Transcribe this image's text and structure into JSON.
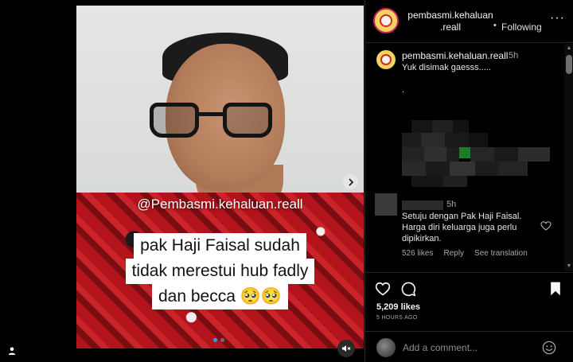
{
  "media": {
    "handle_overlay": "@Pembasmi.kehaluan.reall",
    "caption_lines": [
      "pak Haji Faisal sudah",
      "tidak merestui hub fadly",
      "dan becca 🥺🥺"
    ],
    "carousel": {
      "count": 2,
      "active_index": 0
    },
    "icons": {
      "next": "chevron-right-icon",
      "mute": "speaker-muted-icon",
      "tagged_user": "person-icon"
    }
  },
  "post_header": {
    "username_line1": "pembasmi.kehaluan",
    "username_line2": ".reall",
    "separator": "•",
    "follow_status": "Following",
    "more": "···"
  },
  "caption_comment": {
    "username": "pembasmi.kehaluan.reall",
    "time": "5h",
    "text": "Yuk disimak gaesss.....",
    "extra": "."
  },
  "comment": {
    "time": "5h",
    "text": "Setuju dengan Pak Haji Faisal. Harga diri keluarga juga perlu dipikirkan.",
    "likes": "526 likes",
    "reply": "Reply",
    "translate": "See translation"
  },
  "actions": {
    "likes": "5,209 likes",
    "time_ago": "5 HOURS AGO",
    "icons": [
      "heart-icon",
      "comment-icon",
      "bookmark-icon"
    ]
  },
  "add_comment": {
    "placeholder": "Add a comment..."
  },
  "colors": {
    "background": "#000000",
    "divider": "#262626",
    "secondary_text": "#a8a8a8",
    "accent_blue": "#2f9bff"
  }
}
